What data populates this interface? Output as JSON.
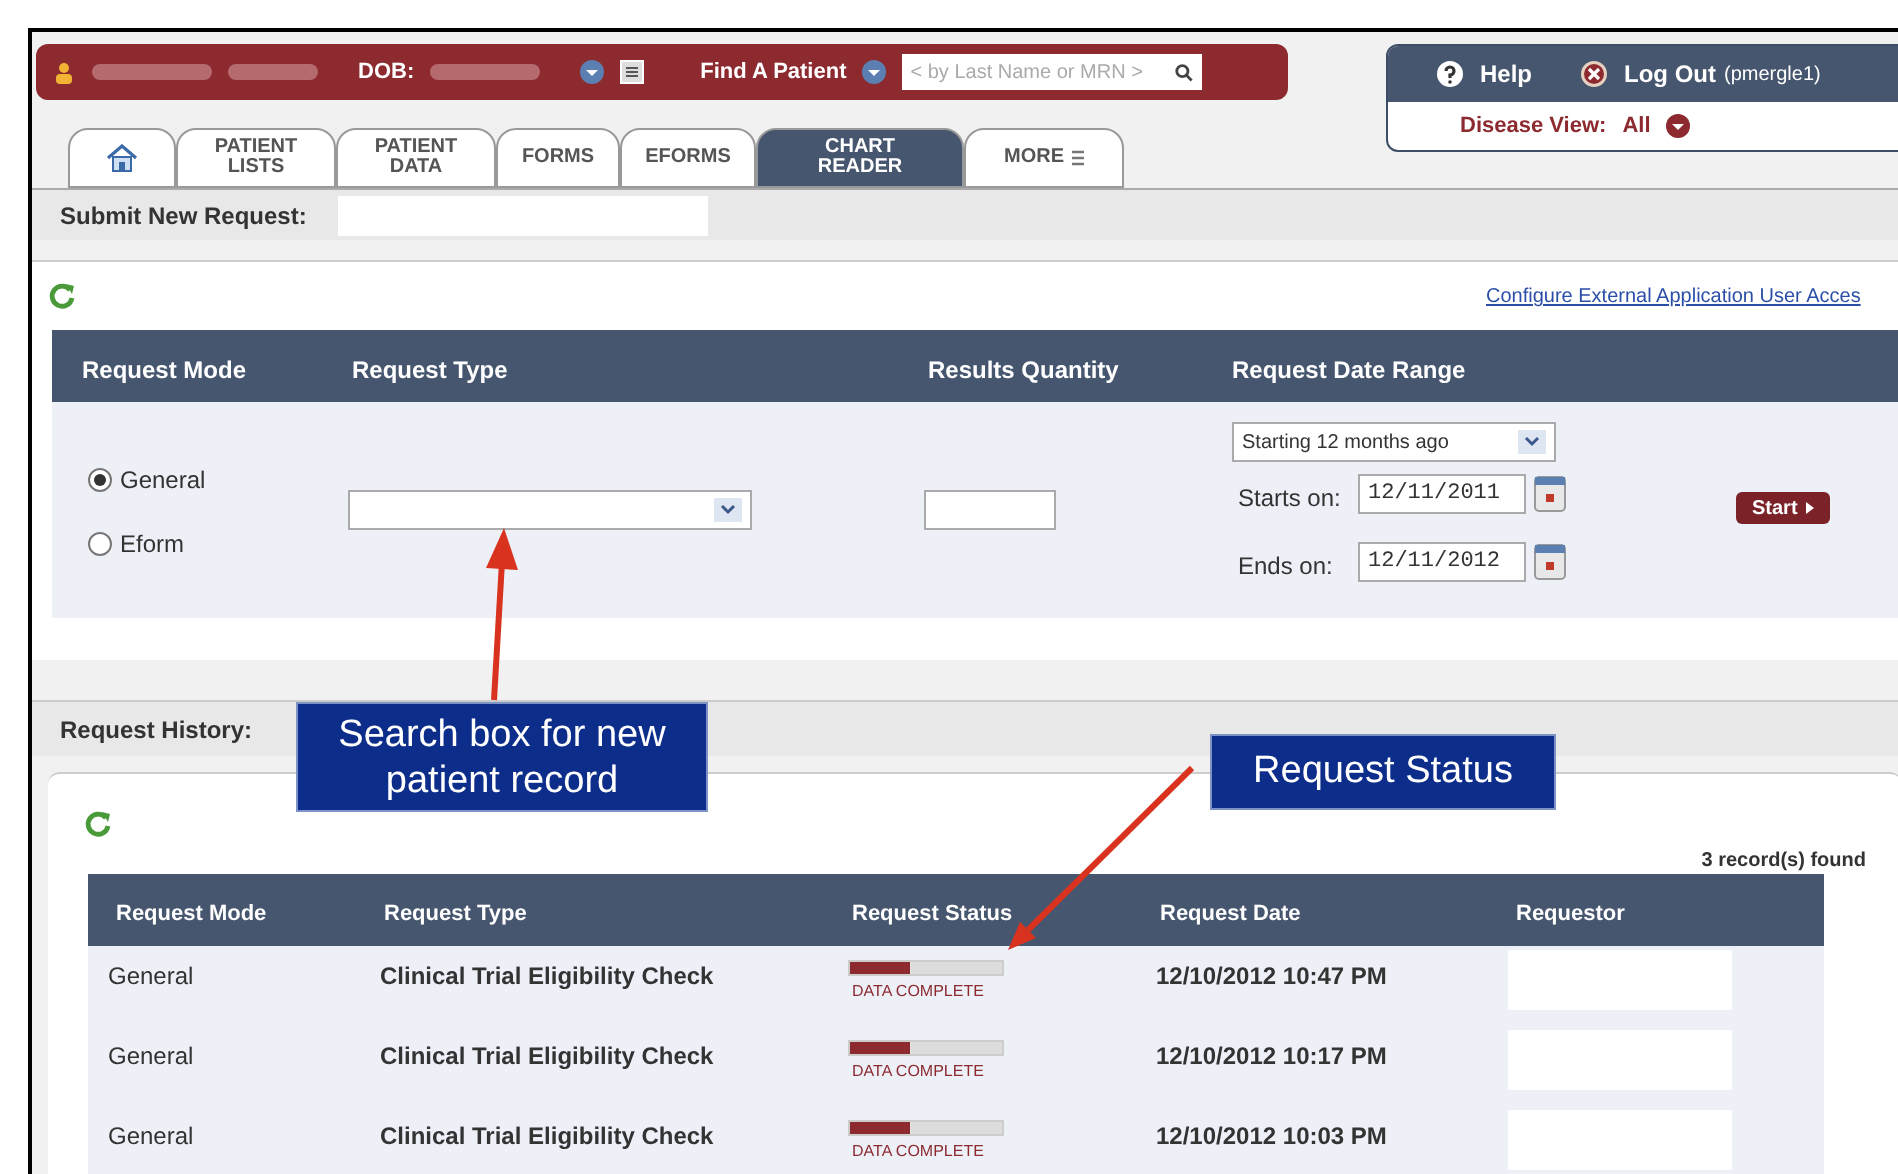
{
  "top_bar": {
    "dob_label": "DOB:",
    "find_label": "Find A Patient",
    "find_placeholder": "< by Last Name or MRN >"
  },
  "account": {
    "help": "Help",
    "logout": "Log Out",
    "user": "(pmergle1)",
    "disease_label": "Disease View:",
    "disease_value": "All"
  },
  "tabs": [
    {
      "kind": "home",
      "selected": false
    },
    {
      "kind": "text",
      "lines": [
        "PATIENT",
        "LISTS"
      ],
      "selected": false
    },
    {
      "kind": "text",
      "lines": [
        "PATIENT",
        "DATA"
      ],
      "selected": false
    },
    {
      "kind": "text",
      "lines": [
        "FORMS"
      ],
      "selected": false
    },
    {
      "kind": "text",
      "lines": [
        "EFORMS"
      ],
      "selected": false
    },
    {
      "kind": "text",
      "lines": [
        "CHART",
        "READER"
      ],
      "selected": true
    },
    {
      "kind": "more",
      "lines": [
        "MORE"
      ],
      "selected": false
    }
  ],
  "submit_title": "Submit New Request:",
  "config_link": "Configure External Application User Acces",
  "request_form": {
    "columns": [
      "Request Mode",
      "Request Type",
      "Results Quantity",
      "Request Date Range"
    ],
    "modes": [
      {
        "label": "General",
        "selected": true
      },
      {
        "label": "Eform",
        "selected": false
      }
    ],
    "range_select": "Starting 12 months ago",
    "starts_label": "Starts on:",
    "starts_value": "12/11/2011",
    "ends_label": "Ends on:",
    "ends_value": "12/11/2012",
    "start_button": "Start"
  },
  "history_title": "Request History:",
  "records_found": "3 record(s) found",
  "history": {
    "columns": [
      "Request Mode",
      "Request Type",
      "Request Status",
      "Request Date",
      "Requestor"
    ],
    "rows": [
      {
        "mode": "General",
        "type": "Clinical Trial Eligibility Check",
        "level": 0.4,
        "status": "DATA COMPLETE",
        "date": "12/10/2012 10:47 PM"
      },
      {
        "mode": "General",
        "type": "Clinical Trial Eligibility Check",
        "level": 0.4,
        "status": "DATA COMPLETE",
        "date": "12/10/2012 10:17 PM"
      },
      {
        "mode": "General",
        "type": "Clinical Trial Eligibility Check",
        "level": 0.4,
        "status": "DATA COMPLETE",
        "date": "12/10/2012 10:03 PM"
      }
    ]
  },
  "callouts": [
    "Search box for new patient record",
    "Request Status"
  ]
}
